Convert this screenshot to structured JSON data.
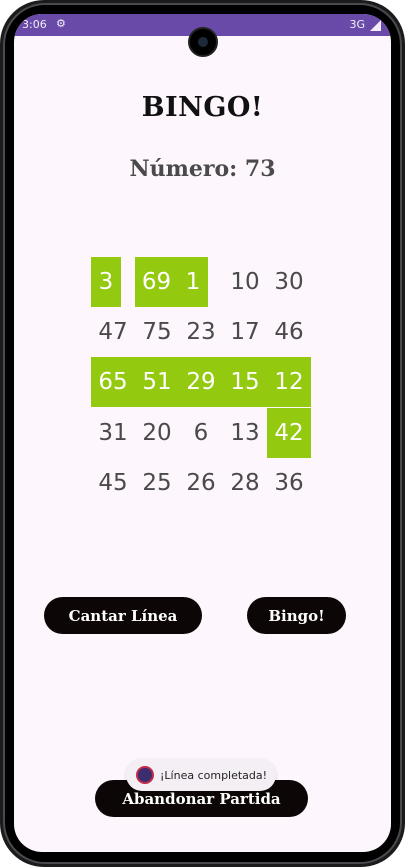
{
  "status_bar": {
    "time": "3:06",
    "network": "3G",
    "settings_icon": "gear-icon",
    "signal_icon": "signal-icon"
  },
  "title": "BINGO!",
  "current_number_label": "Número: 73",
  "card": {
    "rows": [
      [
        {
          "value": "3",
          "marked": true
        },
        {
          "value": "69",
          "marked": true
        },
        {
          "value": "1",
          "marked": true
        },
        {
          "value": "10",
          "marked": false
        },
        {
          "value": "30",
          "marked": false
        }
      ],
      [
        {
          "value": "47",
          "marked": false
        },
        {
          "value": "75",
          "marked": false
        },
        {
          "value": "23",
          "marked": false
        },
        {
          "value": "17",
          "marked": false
        },
        {
          "value": "46",
          "marked": false
        }
      ],
      [
        {
          "value": "65",
          "marked": true
        },
        {
          "value": "51",
          "marked": true
        },
        {
          "value": "29",
          "marked": true
        },
        {
          "value": "15",
          "marked": true
        },
        {
          "value": "12",
          "marked": true
        }
      ],
      [
        {
          "value": "31",
          "marked": false
        },
        {
          "value": "20",
          "marked": false
        },
        {
          "value": "6",
          "marked": false
        },
        {
          "value": "13",
          "marked": false
        },
        {
          "value": "42",
          "marked": true
        }
      ],
      [
        {
          "value": "45",
          "marked": false
        },
        {
          "value": "25",
          "marked": false
        },
        {
          "value": "26",
          "marked": false
        },
        {
          "value": "28",
          "marked": false
        },
        {
          "value": "36",
          "marked": false
        }
      ]
    ],
    "marked_color": "#93c90e"
  },
  "buttons": {
    "cantar_linea": "Cantar Línea",
    "bingo": "Bingo!",
    "abandonar": "Abandonar Partida"
  },
  "toast": {
    "text": "¡Línea completada!",
    "icon": "app-icon"
  }
}
